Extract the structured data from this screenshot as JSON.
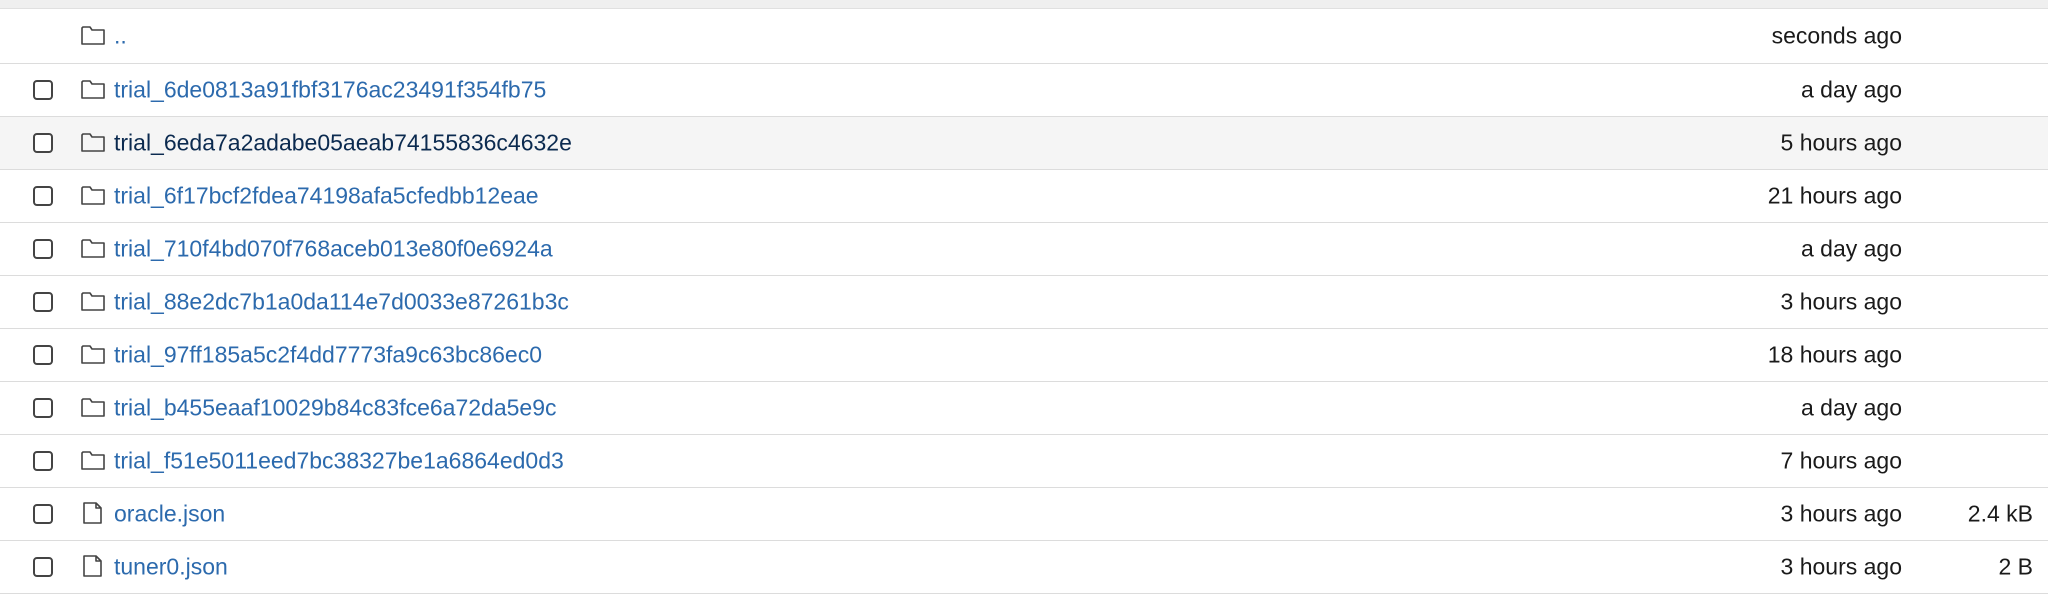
{
  "files": [
    {
      "name": "..",
      "type": "folder",
      "modified": "seconds ago",
      "size": "",
      "checkbox": false
    },
    {
      "name": "trial_6de0813a91fbf3176ac23491f354fb75",
      "type": "folder",
      "modified": "a day ago",
      "size": "",
      "checkbox": true
    },
    {
      "name": "trial_6eda7a2adabe05aeab74155836c4632e",
      "type": "folder",
      "modified": "5 hours ago",
      "size": "",
      "checkbox": true
    },
    {
      "name": "trial_6f17bcf2fdea74198afa5cfedbb12eae",
      "type": "folder",
      "modified": "21 hours ago",
      "size": "",
      "checkbox": true
    },
    {
      "name": "trial_710f4bd070f768aceb013e80f0e6924a",
      "type": "folder",
      "modified": "a day ago",
      "size": "",
      "checkbox": true
    },
    {
      "name": "trial_88e2dc7b1a0da114e7d0033e87261b3c",
      "type": "folder",
      "modified": "3 hours ago",
      "size": "",
      "checkbox": true
    },
    {
      "name": "trial_97ff185a5c2f4dd7773fa9c63bc86ec0",
      "type": "folder",
      "modified": "18 hours ago",
      "size": "",
      "checkbox": true
    },
    {
      "name": "trial_b455eaaf10029b84c83fce6a72da5e9c",
      "type": "folder",
      "modified": "a day ago",
      "size": "",
      "checkbox": true
    },
    {
      "name": "trial_f51e5011eed7bc38327be1a6864ed0d3",
      "type": "folder",
      "modified": "7 hours ago",
      "size": "",
      "checkbox": true
    },
    {
      "name": "oracle.json",
      "type": "file",
      "modified": "3 hours ago",
      "size": "2.4 kB",
      "checkbox": true
    },
    {
      "name": "tuner0.json",
      "type": "file",
      "modified": "3 hours ago",
      "size": "2 B",
      "checkbox": true
    }
  ],
  "icons": {
    "folder": "folder-icon",
    "file": "file-icon"
  },
  "colors": {
    "link": "#2c6aad",
    "hover_link": "#0b2a4f",
    "hover_row": "#f5f5f5",
    "border": "#dcdcdc"
  }
}
